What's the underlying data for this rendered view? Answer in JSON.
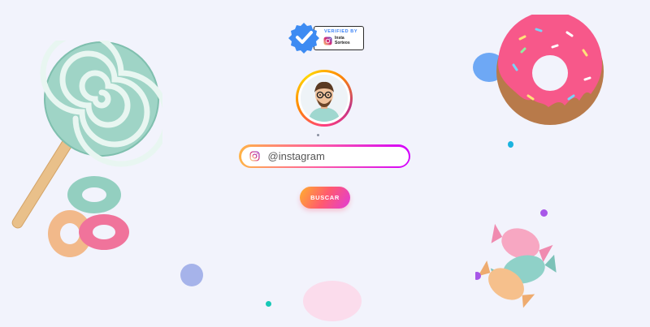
{
  "badge": {
    "verified_label": "VERIFIED BY",
    "brand_line1": "Insta",
    "brand_line2": "Sorteos"
  },
  "search": {
    "placeholder": "@instagram",
    "button_label": "BUSCAR"
  },
  "icons": {
    "badge_seal": "verified-check-icon",
    "brand": "instagram-icon",
    "field": "instagram-icon"
  },
  "colors": {
    "background": "#f2f3fc",
    "accent_blue": "#3b82f6",
    "gradient_start": "#ffb347",
    "gradient_mid": "#ff5f9e",
    "gradient_end": "#d300ff"
  }
}
